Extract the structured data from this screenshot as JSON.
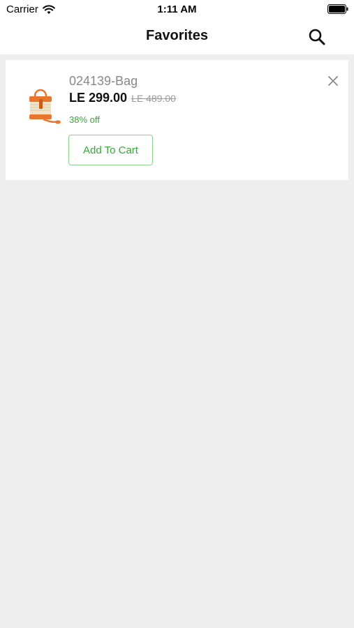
{
  "status_bar": {
    "carrier": "Carrier",
    "time": "1:11 AM",
    "icons": [
      "wifi-icon",
      "battery-icon"
    ]
  },
  "nav": {
    "title": "Favorites",
    "icons": [
      "search-icon"
    ]
  },
  "favorites": [
    {
      "name": "024139-Bag",
      "price": "LE 299.00",
      "old_price": "LE 489.00",
      "discount": "38% off",
      "add_to_cart_label": "Add To Cart",
      "icons": [
        "bag-thumbnail",
        "close-icon"
      ]
    }
  ],
  "colors": {
    "accent_green": "#3aa53a",
    "background": "#eeeeee",
    "card": "#ffffff",
    "bag_orange": "#e8762c"
  }
}
